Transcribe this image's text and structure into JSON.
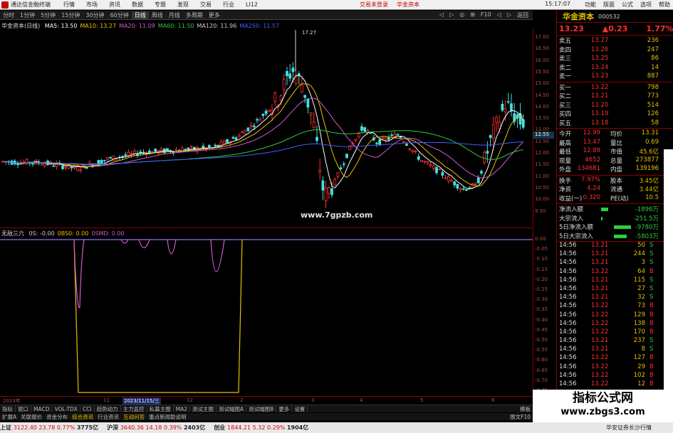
{
  "titlebar": {
    "app": "通达信金融终端",
    "menus": [
      "行情",
      "市场",
      "资讯",
      "数据",
      "专题",
      "发现",
      "交易",
      "行业",
      "LI12"
    ],
    "center": [
      "交易未登录",
      "华金资本"
    ],
    "time": "15:17:07",
    "right_menus": [
      "功能",
      "版面",
      "公式",
      "选项",
      "帮助"
    ]
  },
  "periodbar": {
    "items": [
      "分时",
      "1分钟",
      "5分钟",
      "15分钟",
      "30分钟",
      "60分钟",
      "日线",
      "周线",
      "月线",
      "多周期",
      "更多"
    ],
    "active": "日线",
    "right": [
      "◁",
      "▷",
      "◎",
      "⊞",
      "F10",
      "◁",
      "▷",
      "返回"
    ]
  },
  "main_legend": {
    "name": "华金资本(日线)",
    "items": [
      {
        "text": "MA5: 13.50",
        "color": "#ffffff"
      },
      {
        "text": "MA10: 13.27",
        "color": "#e6c200"
      },
      {
        "text": "MA20: 11.09",
        "color": "#d05ad0"
      },
      {
        "text": "MA60: 11.50",
        "color": "#2ecc40"
      },
      {
        "text": "MA120: 11.96",
        "color": "#cccccc"
      },
      {
        "text": "MA250: 11.57",
        "color": "#4060ff"
      }
    ]
  },
  "main_peak_label": "17.27",
  "main_watermark": "www.7gpzb.com",
  "main_price_tag": "12.55",
  "sub_legend": {
    "name": "无敌三六",
    "items": [
      {
        "text": "0S: -0.00",
        "color": "#cccccc"
      },
      {
        "text": "0BS0: 0.00",
        "color": "#e6c200"
      },
      {
        "text": "0SMD: 0.00",
        "color": "#d05ad0"
      }
    ]
  },
  "xaxis": {
    "labels": [
      "2023年",
      "11",
      "2023/11/15/三",
      "12",
      "2",
      "3",
      "4",
      "5",
      "6"
    ],
    "highlight": "2023/11/15/三"
  },
  "tabs_row1": [
    "指标",
    "窗口",
    "MACD",
    "VOL-TDX",
    "CCI",
    "趋势动力",
    "主力监控",
    "私募主图",
    "MA2",
    "测试主图",
    "测试幅图A",
    "测试幅图B",
    "更多",
    "设置"
  ],
  "tabs_row1_right": "模板",
  "tabs_row2": [
    "扩展A",
    "关联报价",
    "资金分布",
    "综合资讯",
    "行业资讯",
    "互动问答",
    "重点新闻助说明"
  ],
  "tabs_row2_highlight": [
    "综合资讯",
    "互动问答"
  ],
  "tabs_row2_right": "图文F10",
  "statusbar": {
    "items": [
      {
        "label": "上证",
        "value": "3122.40",
        "chg": "23.78",
        "pct": "0.77%",
        "amt": "3775亿"
      },
      {
        "label": "沪深",
        "value": "3640.36",
        "chg": "14.18",
        "pct": "0.39%",
        "amt": "2403亿"
      },
      {
        "label": "创业",
        "value": "1844.21",
        "chg": "5.32",
        "pct": "0.29%",
        "amt": "1904亿"
      }
    ],
    "right": "华安证券长沙行情"
  },
  "right_panel": {
    "name": "华金资本",
    "code": "000532",
    "price": "13.23",
    "change": "▲0.23",
    "pct": "1.77%",
    "asks": [
      {
        "label": "卖五",
        "price": "13.27",
        "vol": "236"
      },
      {
        "label": "卖四",
        "price": "13.26",
        "vol": "247"
      },
      {
        "label": "卖三",
        "price": "13.25",
        "vol": "86"
      },
      {
        "label": "卖二",
        "price": "13.24",
        "vol": "14"
      },
      {
        "label": "卖一",
        "price": "13.23",
        "vol": "887"
      }
    ],
    "bids": [
      {
        "label": "买一",
        "price": "13.22",
        "vol": "798"
      },
      {
        "label": "买二",
        "price": "13.21",
        "vol": "773"
      },
      {
        "label": "买三",
        "price": "13.20",
        "vol": "514"
      },
      {
        "label": "买四",
        "price": "13.19",
        "vol": "126"
      },
      {
        "label": "买五",
        "price": "13.18",
        "vol": "58"
      }
    ],
    "stats": [
      [
        "今开",
        "12.99",
        "均价",
        "13.31"
      ],
      [
        "最高",
        "13.47",
        "量比",
        "0.69"
      ],
      [
        "最低",
        "12.89",
        "市值",
        "45.6亿"
      ],
      [
        "现量",
        "4652",
        "总量",
        "273877"
      ],
      [
        "外盘",
        "134681",
        "内盘",
        "139196"
      ]
    ],
    "stats2": [
      [
        "换手",
        "7.97%",
        "股本",
        "3.45亿"
      ],
      [
        "净资",
        "4.24",
        "流通",
        "3.44亿"
      ],
      [
        "收益(一)",
        "0.320",
        "PE(动)",
        "10.5"
      ]
    ],
    "flows": [
      {
        "label": "净流入额",
        "value": "-1896万",
        "bar": 0.25
      },
      {
        "label": "大宗流入",
        "value": "-251.5万",
        "bar": 0.05
      },
      {
        "label": "5日净流入额",
        "value": "-9780万",
        "bar": 0.6
      },
      {
        "label": "5日大宗流入",
        "value": "-5803万",
        "bar": 0.45
      }
    ],
    "ticks": [
      [
        "14:56",
        "13.21",
        "50",
        "S"
      ],
      [
        "14:56",
        "13.21",
        "244",
        "S"
      ],
      [
        "14:56",
        "13.21",
        "3",
        "S"
      ],
      [
        "14:56",
        "13.22",
        "64",
        "B"
      ],
      [
        "14:56",
        "13.21",
        "115",
        "S"
      ],
      [
        "14:56",
        "13.21",
        "27",
        "S"
      ],
      [
        "14:56",
        "13.21",
        "32",
        "S"
      ],
      [
        "14:56",
        "13.22",
        "73",
        "B"
      ],
      [
        "14:56",
        "13.22",
        "129",
        "B"
      ],
      [
        "14:56",
        "13.22",
        "138",
        "B"
      ],
      [
        "14:56",
        "13.22",
        "170",
        "B"
      ],
      [
        "14:56",
        "13.21",
        "237",
        "S"
      ],
      [
        "14:56",
        "13.21",
        "8",
        "S"
      ],
      [
        "14:56",
        "13.22",
        "127",
        "B"
      ],
      [
        "14:56",
        "13.22",
        "29",
        "B"
      ],
      [
        "14:56",
        "13.22",
        "102",
        "B"
      ],
      [
        "14:56",
        "13.22",
        "12",
        "B"
      ]
    ]
  },
  "yaxis_main": [
    "17.00",
    "16.50",
    "16.00",
    "15.50",
    "15.00",
    "14.50",
    "14.00",
    "13.50",
    "13.00",
    "12.50",
    "12.00",
    "11.50",
    "11.00",
    "10.50",
    "10.00",
    "9.50"
  ],
  "yaxis_sub": [
    "0.00",
    "-0.05",
    "-0.10",
    "-0.15",
    "-0.20",
    "-0.25",
    "-0.30",
    "-0.35",
    "-0.40",
    "-0.45",
    "-0.50",
    "-0.55",
    "-0.60",
    "-0.65",
    "-0.70",
    "-0.75"
  ],
  "big_watermark": {
    "line1": "指标公式网",
    "line2": "www.zbgs3.com"
  },
  "colors": {
    "up": "#ff3030",
    "down": "#40e0e0",
    "frame": "#8b0000",
    "yellow": "#e6c200"
  }
}
